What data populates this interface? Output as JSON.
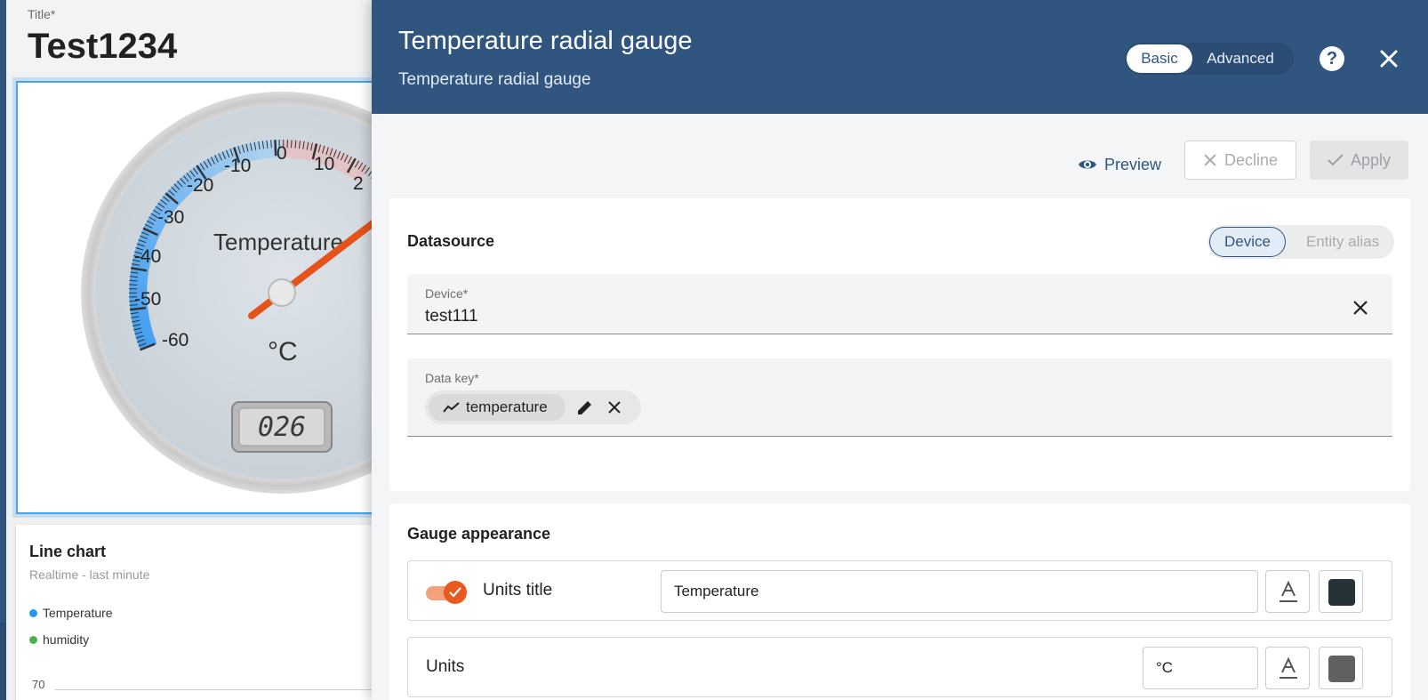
{
  "dashboard": {
    "title_label": "Title*",
    "title_value": "Test1234",
    "gauge": {
      "ticks": [
        "-60",
        "-50",
        "-40",
        "-30",
        "-20",
        "-10",
        "0",
        "10",
        "2"
      ],
      "title": "Temperature",
      "units": "°C",
      "value_display": "026",
      "value": 26
    },
    "line_chart": {
      "title": "Line chart",
      "subtitle": "Realtime - last minute",
      "legend": [
        {
          "label": "Temperature",
          "color": "#2196f3"
        },
        {
          "label": "humidity",
          "color": "#4caf50"
        }
      ],
      "y_tick": "70"
    }
  },
  "panel": {
    "title": "Temperature radial gauge",
    "subtitle": "Temperature radial gauge",
    "mode_basic": "Basic",
    "mode_advanced": "Advanced",
    "help_icon": "help-circle-icon",
    "close_icon": "close-icon",
    "actions": {
      "preview": "Preview",
      "decline": "Decline",
      "apply": "Apply"
    },
    "datasource": {
      "title": "Datasource",
      "type_device": "Device",
      "type_alias": "Entity alias",
      "device_label": "Device*",
      "device_value": "test111",
      "datakey_label": "Data key*",
      "datakey_chip": "temperature"
    },
    "appearance": {
      "title": "Gauge appearance",
      "units_title_label": "Units title",
      "units_title_value": "Temperature",
      "units_title_enabled": true,
      "units_title_color": "#263238",
      "units_label": "Units",
      "units_value": "°C",
      "units_color": "#616161"
    }
  },
  "colors": {
    "header": "#305680",
    "accent": "#e85a1f"
  }
}
